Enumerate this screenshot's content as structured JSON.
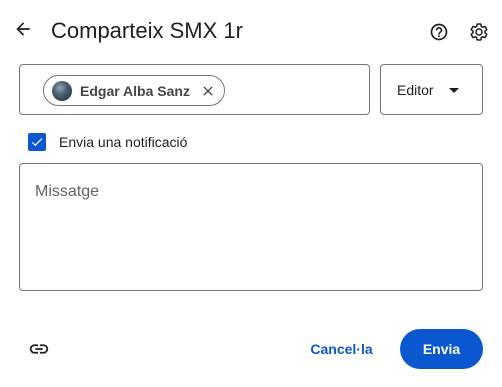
{
  "header": {
    "title": "Comparteix SMX 1r",
    "back_icon": "arrow-back-icon",
    "help_icon": "help-circle-icon",
    "settings_icon": "gear-icon"
  },
  "share": {
    "chips": [
      {
        "label": "Edgar Alba Sanz",
        "avatar_icon": "avatar",
        "close_icon": "close-icon"
      }
    ],
    "role": {
      "selected": "Editor",
      "caret_icon": "caret-down-icon"
    }
  },
  "notify": {
    "checked": true,
    "label": "Envia una notificació"
  },
  "message": {
    "placeholder": "Missatge"
  },
  "footer": {
    "link_icon": "link-icon",
    "cancel_label": "Cancel·la",
    "send_label": "Envia"
  },
  "colors": {
    "accent": "#0b57d0",
    "text": "#1f1f1f",
    "border": "#747775"
  }
}
